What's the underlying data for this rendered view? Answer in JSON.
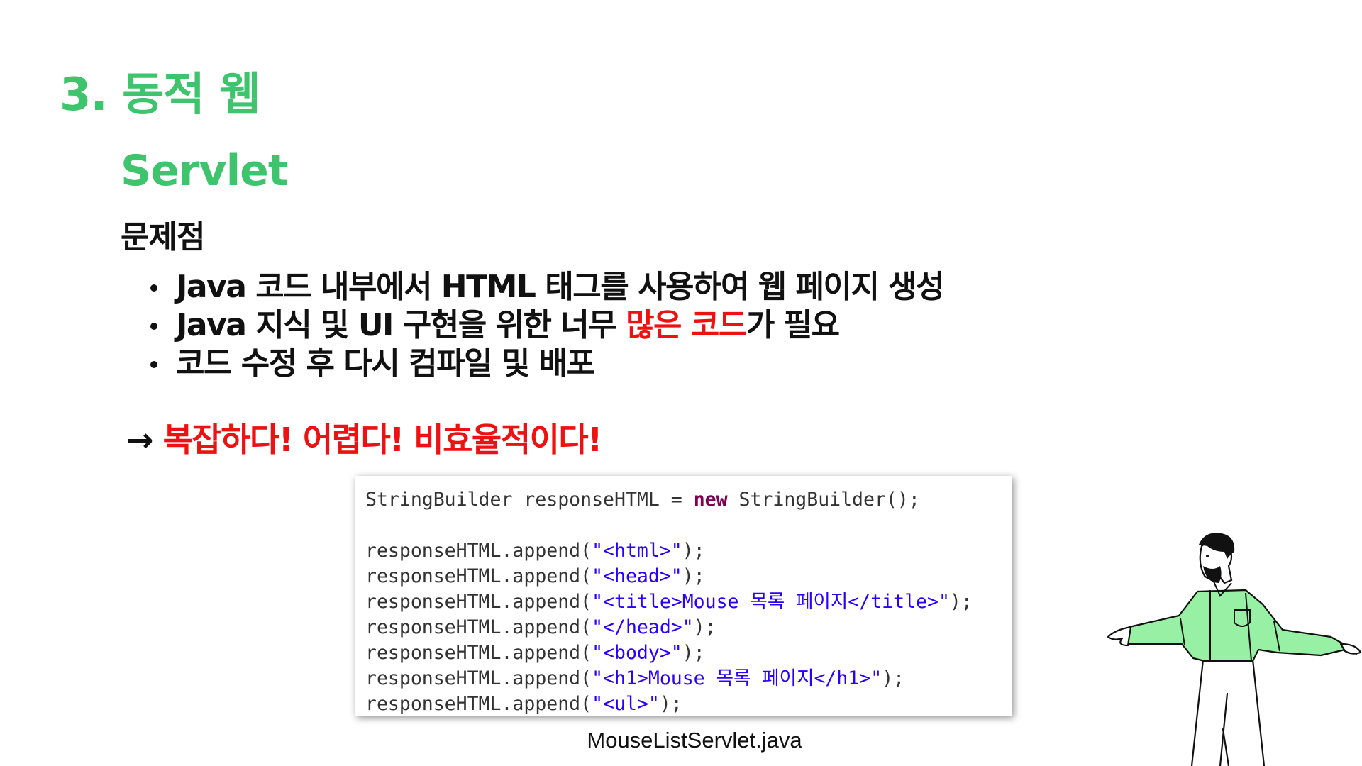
{
  "colors": {
    "accent_green": "#3ec46d",
    "emphasis_red": "#ee1111",
    "text": "#111111",
    "code_keyword": "#7f0055",
    "code_string": "#2a00ff",
    "code_plain": "#333333",
    "figure_shirt": "#98f0a5"
  },
  "slide": {
    "section_title": "3. 동적 웹",
    "topic_title": "Servlet",
    "problem_heading": "문제점",
    "bullets": [
      {
        "parts": [
          {
            "text": "Java 코드 내부에서 HTML 태그를 사용하여 웹 페이지 생성",
            "red": false
          }
        ]
      },
      {
        "parts": [
          {
            "text": "Java 지식 및 UI 구현을 위한 너무 ",
            "red": false
          },
          {
            "text": "많은 코드",
            "red": true
          },
          {
            "text": "가 필요",
            "red": false
          }
        ]
      },
      {
        "parts": [
          {
            "text": "코드 수정 후 다시 컴파일 및 배포",
            "red": false
          }
        ]
      }
    ],
    "conclusion_arrow": "→ ",
    "conclusion_text": "복잡하다! 어렵다! 비효율적이다!"
  },
  "code_snippet": {
    "lines": [
      [
        {
          "t": "StringBuilder responseHTML = ",
          "c": "plain"
        },
        {
          "t": "new",
          "c": "keyword"
        },
        {
          "t": " StringBuilder();",
          "c": "plain"
        }
      ],
      [],
      [
        {
          "t": "responseHTML.append(",
          "c": "plain"
        },
        {
          "t": "\"<html>\"",
          "c": "string"
        },
        {
          "t": ");",
          "c": "plain"
        }
      ],
      [
        {
          "t": "responseHTML.append(",
          "c": "plain"
        },
        {
          "t": "\"<head>\"",
          "c": "string"
        },
        {
          "t": ");",
          "c": "plain"
        }
      ],
      [
        {
          "t": "responseHTML.append(",
          "c": "plain"
        },
        {
          "t": "\"<title>Mouse 목록 페이지</title>\"",
          "c": "string"
        },
        {
          "t": ");",
          "c": "plain"
        }
      ],
      [
        {
          "t": "responseHTML.append(",
          "c": "plain"
        },
        {
          "t": "\"</head>\"",
          "c": "string"
        },
        {
          "t": ");",
          "c": "plain"
        }
      ],
      [
        {
          "t": "responseHTML.append(",
          "c": "plain"
        },
        {
          "t": "\"<body>\"",
          "c": "string"
        },
        {
          "t": ");",
          "c": "plain"
        }
      ],
      [
        {
          "t": "responseHTML.append(",
          "c": "plain"
        },
        {
          "t": "\"<h1>Mouse 목록 페이지</h1>\"",
          "c": "string"
        },
        {
          "t": ");",
          "c": "plain"
        }
      ],
      [
        {
          "t": "responseHTML.append(",
          "c": "plain"
        },
        {
          "t": "\"<ul>\"",
          "c": "string"
        },
        {
          "t": ");",
          "c": "plain"
        }
      ]
    ],
    "caption": "MouseListServlet.java"
  }
}
